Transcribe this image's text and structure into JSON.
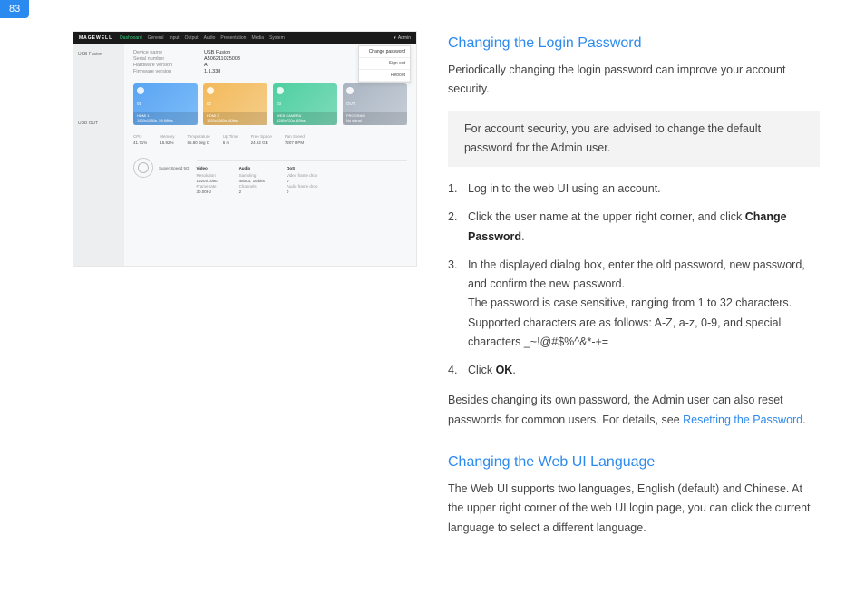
{
  "page_number": "83",
  "section1": {
    "title": "Changing the Login Password",
    "intro": "Periodically changing the login password can improve your account security.",
    "note": "For account security, you are advised to change the default password for the Admin user.",
    "steps": {
      "s1": "Log in to the web UI using an account.",
      "s2a": "Click the user name at the upper right corner, and click ",
      "s2b": "Change Password",
      "s2c": ".",
      "s3a": "In the displayed dialog box, enter the old password, new password, and confirm the new password.",
      "s3b": "The password is case sensitive, ranging from 1 to 32 characters. Supported characters are as follows: A-Z, a-z, 0-9, and special characters _~!@#$%^&*-+=",
      "s4a": "Click ",
      "s4b": "OK",
      "s4c": "."
    },
    "outro1": "Besides changing its own password, the Admin user can also reset passwords for common users. For details, see ",
    "outro_link": "Resetting the Password",
    "outro2": "."
  },
  "section2": {
    "title": "Changing the Web UI Language",
    "body": "The Web UI supports two languages, English (default) and Chinese. At the upper right corner of the web UI login page, you can click the current language to select a different language."
  },
  "mock": {
    "brand": "MAGEWELL",
    "nav": [
      "Dashboard",
      "General",
      "Input",
      "Output",
      "Audio",
      "Presentation",
      "Media",
      "System"
    ],
    "user": "Admin",
    "dropdown": [
      "Change password",
      "Sign out",
      "Reboot"
    ],
    "side1": "USB Fusion",
    "side2": "USB OUT",
    "kv": [
      {
        "k": "Device name",
        "v": "USB Fusion"
      },
      {
        "k": "Serial number",
        "v": "A506211025003"
      },
      {
        "k": "Hardware version",
        "v": "A"
      },
      {
        "k": "Firmware version",
        "v": "1.1.338"
      }
    ],
    "cards": [
      {
        "top": "01",
        "mid": "HDMI 1",
        "bot": "1920x1080p, 59.99fps"
      },
      {
        "top": "02",
        "mid": "HDMI 2",
        "bot": "1920x1080p, 60fps"
      },
      {
        "top": "03",
        "mid": "WEB CAMERA",
        "bot": "1280x720p, 60fps"
      },
      {
        "top": "OUT",
        "mid": "PROGRAM",
        "bot": "No signal"
      }
    ],
    "stats": [
      {
        "k": "CPU",
        "v": "41.71%"
      },
      {
        "k": "Memory",
        "v": "15.92%"
      },
      {
        "k": "Temperature",
        "v": "65.80 deg C"
      },
      {
        "k": "Up Time",
        "v": "6 m"
      },
      {
        "k": "Free Space",
        "v": "24.62 GB"
      },
      {
        "k": "Fan Speed",
        "v": "7207 RPM"
      }
    ],
    "usbout_label": "Super Speed 5G",
    "spec": {
      "video": {
        "h": "Video",
        "r1": "Resolution",
        "r1v": "1920X1080",
        "r2": "Frame rate",
        "r2v": "30.00Hz"
      },
      "audio": {
        "h": "Audio",
        "r1": "Sampling",
        "r1v": "48000, 16 bits",
        "r2": "Channels",
        "r2v": "2"
      },
      "qos": {
        "h": "QoS",
        "r1": "Video frame drop",
        "r1v": "0",
        "r2": "Audio frame drop",
        "r2v": "0"
      }
    }
  }
}
